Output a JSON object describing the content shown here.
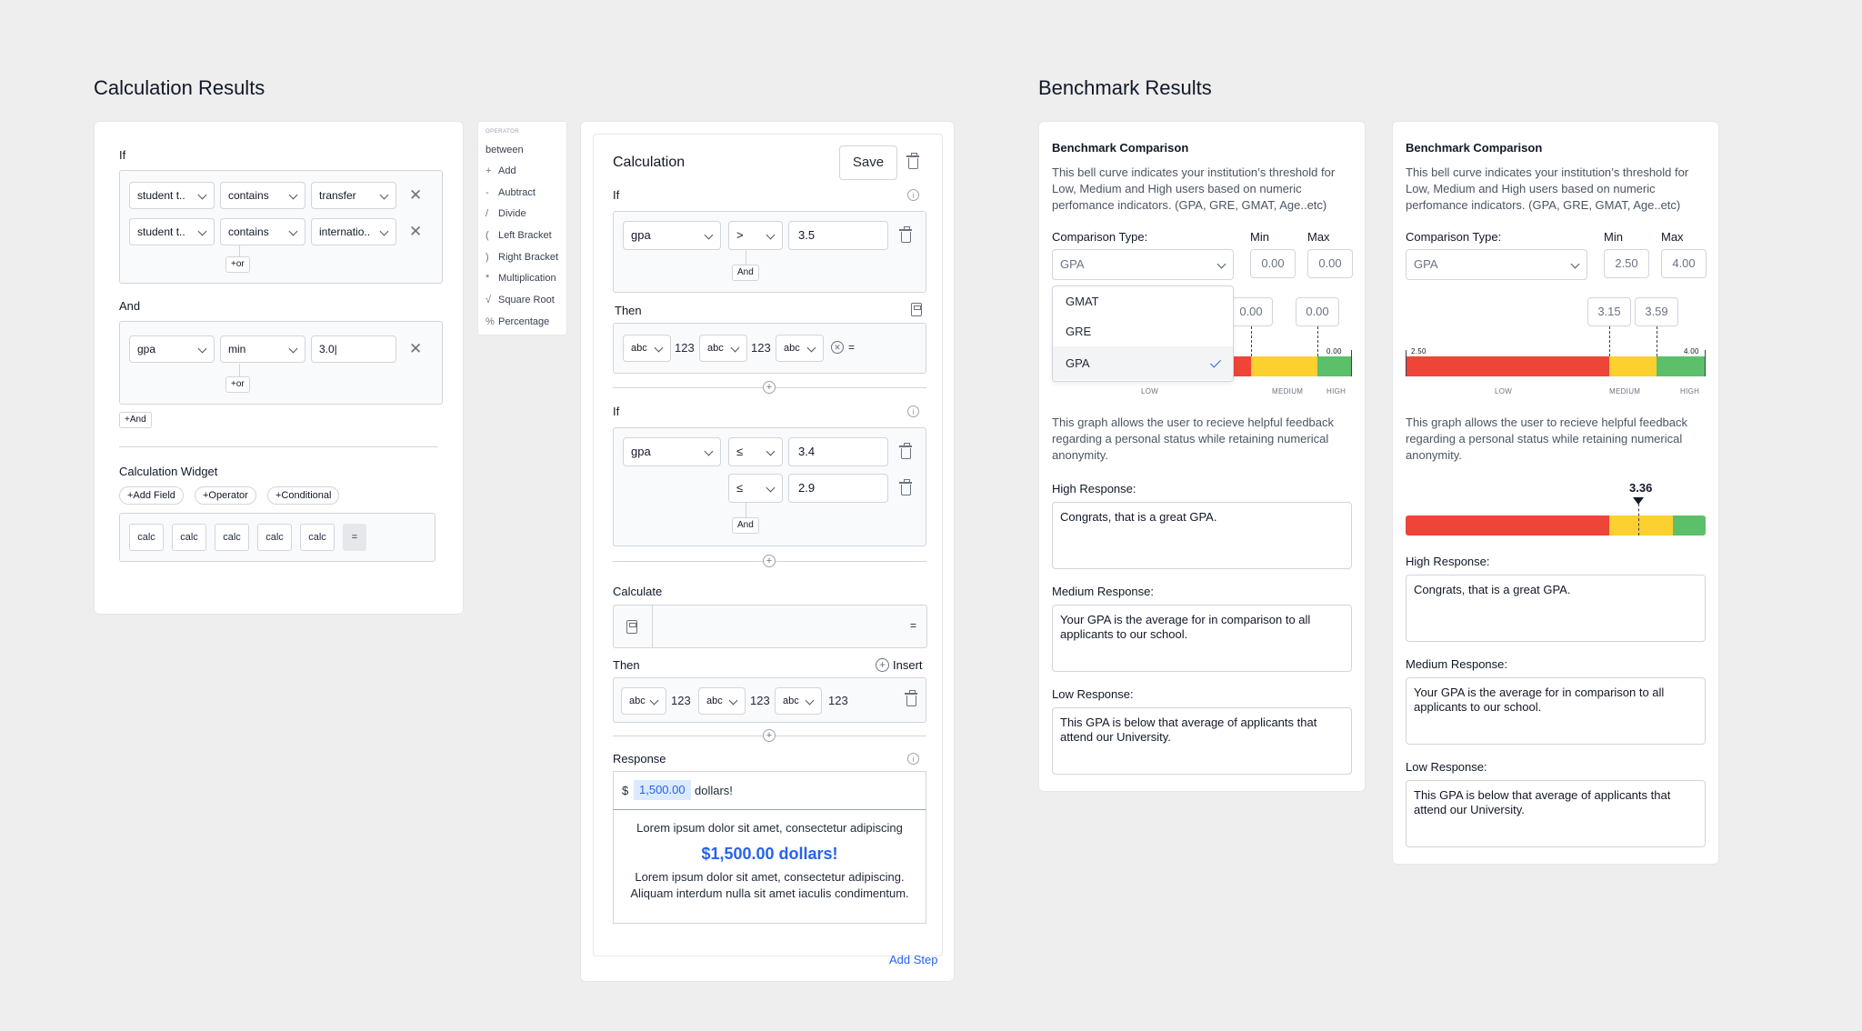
{
  "headings": {
    "calc": "Calculation Results",
    "bench": "Benchmark Results"
  },
  "left_card": {
    "if_label": "If",
    "rows": [
      {
        "field": "student t..",
        "op": "contains",
        "value": "transfer"
      },
      {
        "field": "student t..",
        "op": "contains",
        "value": "internatio.."
      }
    ],
    "or1": "+or",
    "and_label": "And",
    "and_row": {
      "field": "gpa",
      "op": "min",
      "value": "3.0|"
    },
    "or2": "+or",
    "and_btn": "+And",
    "widget_title": "Calculation Widget",
    "widget_buttons": [
      "+Add Field",
      "+Operator",
      "+Conditional"
    ],
    "calc_items": [
      "calc",
      "calc",
      "calc",
      "calc",
      "calc"
    ],
    "equals": "="
  },
  "operator_menu": {
    "header": "OPERATOR",
    "first": "between",
    "items": [
      {
        "sym": "+",
        "label": "Add"
      },
      {
        "sym": "-",
        "label": "Aubtract"
      },
      {
        "sym": "/",
        "label": "Divide"
      },
      {
        "sym": "(",
        "label": "Left Bracket"
      },
      {
        "sym": ")",
        "label": "Right Bracket"
      },
      {
        "sym": "*",
        "label": "Multiplication"
      },
      {
        "sym": "√",
        "label": "Square Root"
      },
      {
        "sym": "%",
        "label": "Percentage"
      }
    ]
  },
  "calc_panel": {
    "title": "Calculation",
    "save": "Save",
    "if1": {
      "label": "If",
      "field": "gpa",
      "op": ">",
      "value": "3.5",
      "and": "And"
    },
    "then1": {
      "label": "Then",
      "tokens": [
        "abc",
        "123",
        "abc",
        "123",
        "abc"
      ],
      "eq": "="
    },
    "if2": {
      "label": "If",
      "field": "gpa",
      "op1": "≤",
      "value1": "3.4",
      "op2": "≤",
      "value2": "2.9",
      "and": "And"
    },
    "calculate": {
      "label": "Calculate",
      "eq": "="
    },
    "then2": {
      "label": "Then",
      "insert": "Insert",
      "tokens": [
        "abc",
        "123",
        "abc",
        "123",
        "abc",
        "123"
      ]
    },
    "response": {
      "label": "Response",
      "currency": "$",
      "amount": "1,500.00",
      "suffix": "dollars!",
      "preview_line1": "Lorem ipsum dolor sit amet, consectetur adipiscing",
      "preview_amount": "$1,500.00 dollars!",
      "preview_line2": "Lorem ipsum dolor sit amet, consectetur adipiscing. Aliquam interdum nulla sit amet iaculis condimentum."
    },
    "add_step": "Add Step"
  },
  "bench_left": {
    "title": "Benchmark Comparison",
    "desc": "This bell curve indicates your institution’s threshold for Low, Medium and High users based on numeric perfomance indicators. (GPA, GRE, GMAT, Age..etc)",
    "type_label": "Comparison Type:",
    "min_label": "Min",
    "max_label": "Max",
    "type_value": "GPA",
    "min_value": "0.00",
    "max_value": "0.00",
    "marker1": "0.00",
    "marker2": "0.00",
    "end_label": "0.00",
    "dropdown": [
      "GMAT",
      "GRE",
      "GPA"
    ],
    "selected": "GPA",
    "bar_labels": {
      "low": "LOW",
      "medium": "MEDIUM",
      "high": "HIGH"
    },
    "graph_desc": "This graph allows the user to recieve helpful feedback regarding a personal status while retaining numerical anonymity.",
    "high_label": "High Response:",
    "high_text": "Congrats, that is a great GPA.",
    "medium_label": "Medium Response:",
    "medium_text": "Your GPA is the average for in comparison to all applicants to our school.",
    "low_label": "Low Response:",
    "low_text": "This GPA is below that average of applicants that attend our University."
  },
  "bench_right": {
    "title": "Benchmark Comparison",
    "desc": "This bell curve indicates your institution’s threshold for Low, Medium and High users based on numeric perfomance indicators. (GPA, GRE, GMAT, Age..etc)",
    "type_label": "Comparison Type:",
    "min_label": "Min",
    "max_label": "Max",
    "type_value": "GPA",
    "min_value": "2.50",
    "max_value": "4.00",
    "marker1": "3.15",
    "marker2": "3.59",
    "start_label": "2.50",
    "end_label": "4.00",
    "bar_labels": {
      "low": "LOW",
      "medium": "MEDIUM",
      "high": "HIGH"
    },
    "graph_desc": "This graph allows the user to recieve helpful feedback regarding a personal status while retaining numerical anonymity.",
    "score": "3.36",
    "high_label": "High Response:",
    "high_text": "Congrats, that is a great GPA.",
    "medium_label": "Medium Response:",
    "medium_text": "Your GPA is the average for in comparison to all applicants to our school.",
    "low_label": "Low Response:",
    "low_text": "This GPA is below that average of applicants that attend our University."
  },
  "colors": {
    "low": "#ef4438",
    "medium": "#fcd02f",
    "high": "#5cbf69",
    "link": "#2563eb"
  }
}
